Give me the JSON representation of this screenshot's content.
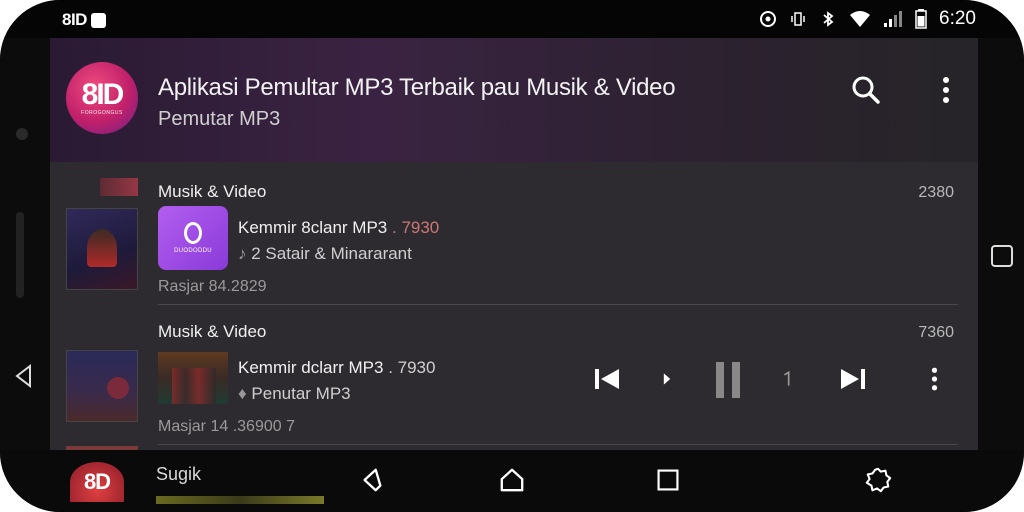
{
  "status_bar": {
    "app_label": "8ID",
    "time": "6:20",
    "icons": [
      "app-icon",
      "alarm-icon",
      "vibrate-icon",
      "bluetooth-icon",
      "wifi-icon",
      "signal-icon",
      "battery-icon"
    ]
  },
  "header": {
    "logo_text": "8ID",
    "logo_subtext": "FOROGONGUS",
    "title": "Aplikasi Pemultar MP3 Terbaik pau Musik & Video",
    "subtitle": "Pemutar MP3"
  },
  "rows": [
    {
      "category": "Musik & Video",
      "count": "2380",
      "song_title": "Kemmir 8clanr MP3",
      "song_tail": ". 7930",
      "artist": "2 Satair & Minararant",
      "date": "Rasjar 84.2829",
      "art_label": "DUODODDU"
    },
    {
      "category": "Musik & Video",
      "count": "7360",
      "song_title": "Kemmir dclarr MP3",
      "song_tail": ". 7930",
      "artist": "Penutar MP3",
      "date": "Masjar 14 .36900 7"
    }
  ],
  "bottom_nav": {
    "logo_text": "8D",
    "label": "Sugik"
  },
  "colors": {
    "accent_purple": "#9b4de6",
    "logo_pink": "#e0407a",
    "background": "#2d2b2f"
  }
}
